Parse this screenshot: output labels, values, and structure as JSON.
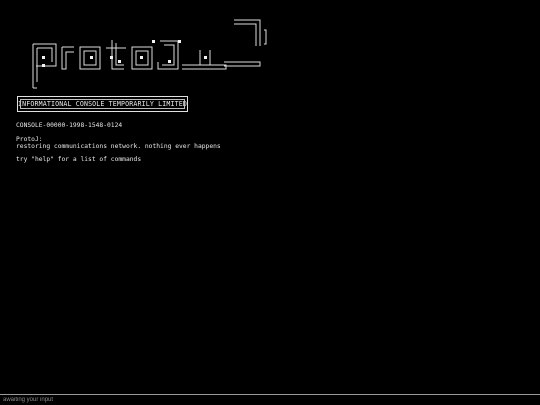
{
  "logo": {
    "name": "protoj-ascii-logo"
  },
  "notice": {
    "text": "INFORMATIONAL CONSOLE TEMPORARILY LIMITED"
  },
  "console": {
    "id_line": "CONSOLE-00000-1998-1548-0124",
    "sender": "ProtoJ:",
    "message": "restoring communications network. nothing ever happens",
    "hint": "try \"help\" for a list of commands"
  },
  "input": {
    "placeholder": "awaiting your input",
    "value": ""
  },
  "colors": {
    "background": "#000000",
    "foreground": "#e8e8e8",
    "input_border": "#9a9a9a"
  }
}
